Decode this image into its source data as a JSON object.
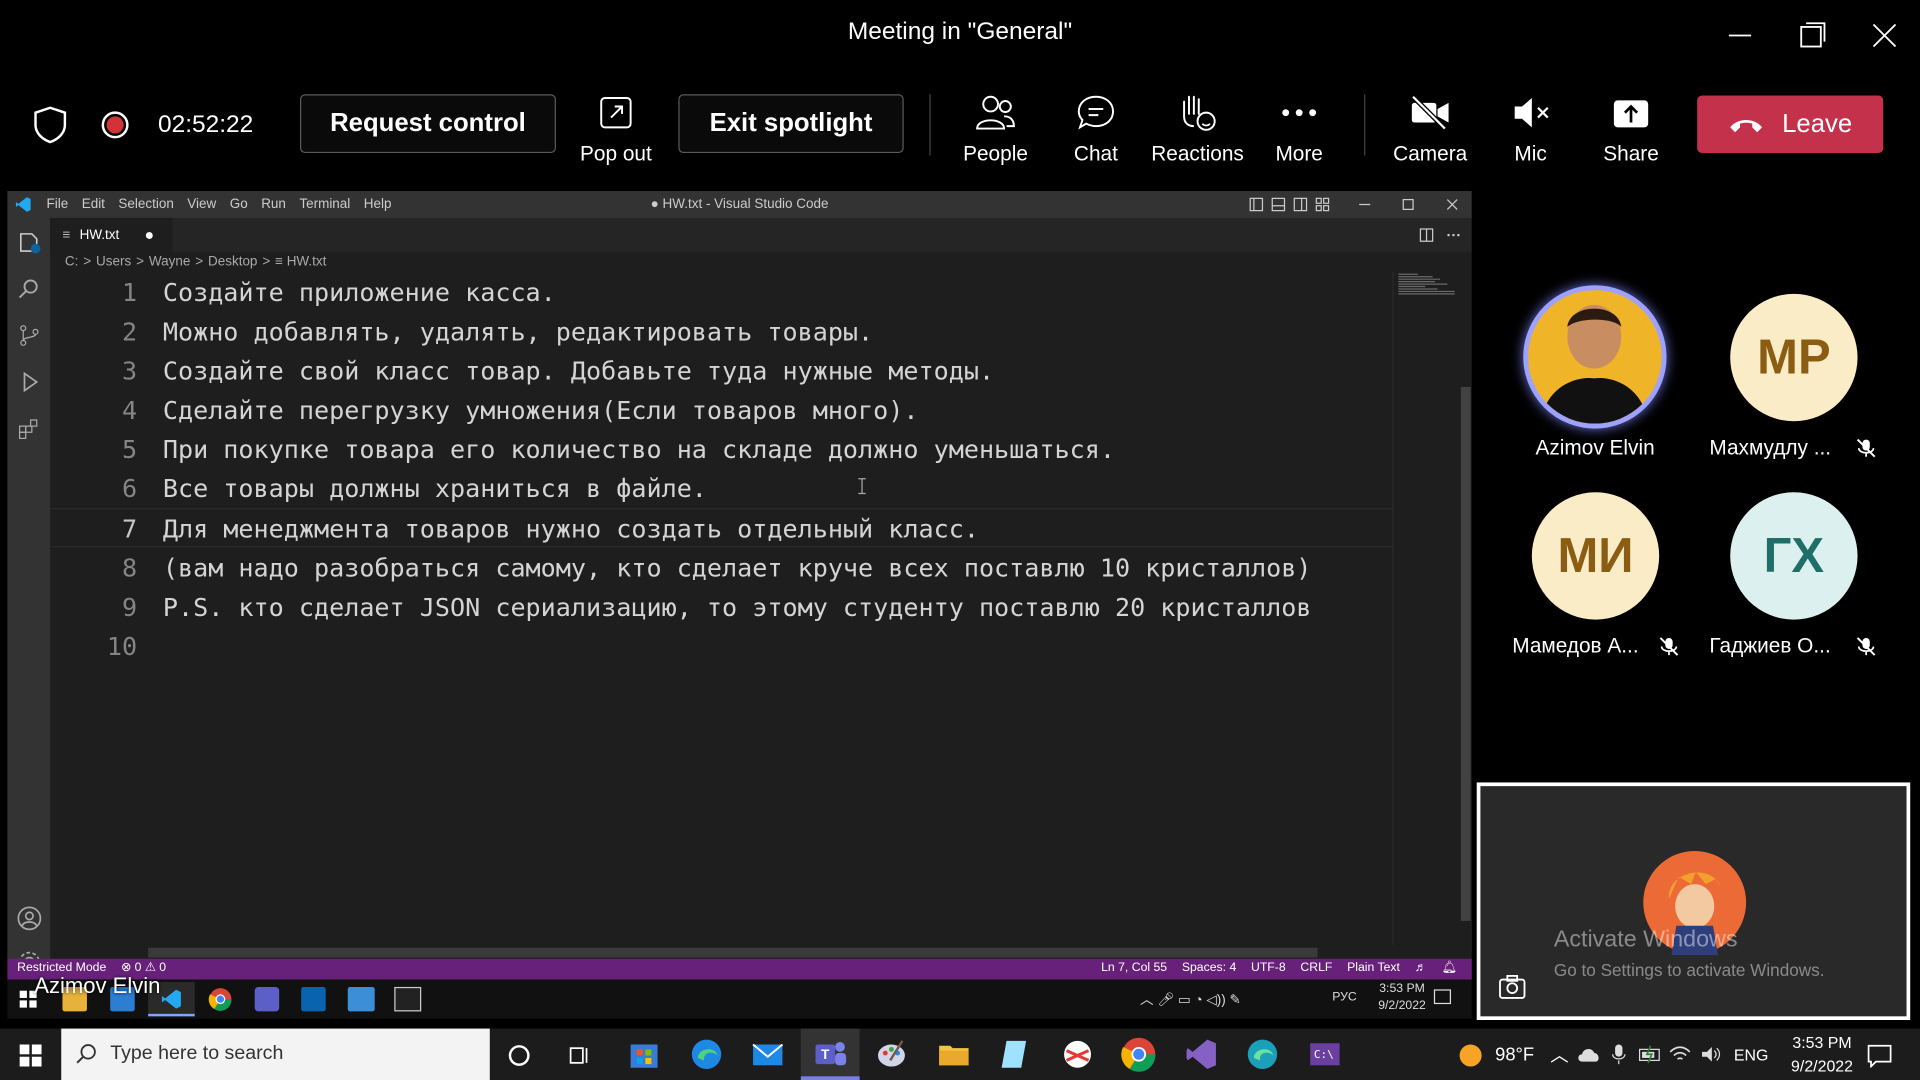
{
  "window": {
    "title": "Meeting in \"General\""
  },
  "toolbar": {
    "timer": "02:52:22",
    "request_control": "Request control",
    "pop_out": "Pop out",
    "exit_spotlight": "Exit spotlight",
    "people": "People",
    "chat": "Chat",
    "reactions": "Reactions",
    "more": "More",
    "camera": "Camera",
    "mic": "Mic",
    "share": "Share",
    "leave": "Leave"
  },
  "vscode": {
    "menu": [
      "File",
      "Edit",
      "Selection",
      "View",
      "Go",
      "Run",
      "Terminal",
      "Help"
    ],
    "window_title": "● HW.txt - Visual Studio Code",
    "tab": "HW.txt",
    "breadcrumb": [
      "C:",
      ">",
      "Users",
      ">",
      "Wayne",
      ">",
      "Desktop",
      ">",
      "≡ HW.txt"
    ],
    "lines": [
      {
        "num": "1",
        "text": "Создайте приложение касса."
      },
      {
        "num": "2",
        "text": "Можно добавлять, удалять, редактировать товары."
      },
      {
        "num": "3",
        "text": "Создайте свой класс товар. Добавьте туда нужные методы."
      },
      {
        "num": "4",
        "text": "Сделайте перегрузку умножения(Если товаров много)."
      },
      {
        "num": "5",
        "text": "При покупке товара его количество на складе должно уменьшаться."
      },
      {
        "num": "6",
        "text": "Все товары должны храниться в файле."
      },
      {
        "num": "7",
        "text": "Для менеджмента товаров нужно создать отдельный класс."
      },
      {
        "num": "8",
        "text": "(вам надо разобраться самому, кто сделает круче всех поставлю 10 кристаллов)"
      },
      {
        "num": "9",
        "text": "P.S. кто сделает JSON сериализацию, то этому студенту поставлю 20 кристаллов"
      },
      {
        "num": "10",
        "text": ""
      }
    ],
    "status": {
      "restricted": "Restricted Mode",
      "problems": "⊗ 0 ⚠ 0",
      "position": "Ln 7, Col 55",
      "spaces": "Spaces: 4",
      "encoding": "UTF-8",
      "eol": "CRLF",
      "language": "Plain Text"
    }
  },
  "inner_taskbar": {
    "presenter": "Azimov Elvin",
    "lang": "РУС",
    "time": "3:53 PM",
    "date": "9/2/2022"
  },
  "participants": [
    {
      "name": "Azimov Elvin",
      "initials": "",
      "muted": false,
      "speaking": true
    },
    {
      "name": "Махмудлу ...",
      "initials": "МР",
      "muted": true,
      "color": "#fbecc8"
    },
    {
      "name": "Мамедов А...",
      "initials": "МИ",
      "muted": true,
      "color": "#fbecc8"
    },
    {
      "name": "Гаджиев О...",
      "initials": "ГХ",
      "muted": true,
      "color": "#dcf1ef"
    }
  ],
  "watermark": {
    "line1": "Activate Windows",
    "line2": "Go to Settings to activate Windows."
  },
  "taskbar": {
    "search_placeholder": "Type here to search",
    "weather": "98°F",
    "lang": "ENG",
    "time": "3:53 PM",
    "date": "9/2/2022"
  },
  "colors": {
    "leave": "#c4314b",
    "vscode_status": "#68217a",
    "speaking_ring": "#9ea2ff"
  }
}
